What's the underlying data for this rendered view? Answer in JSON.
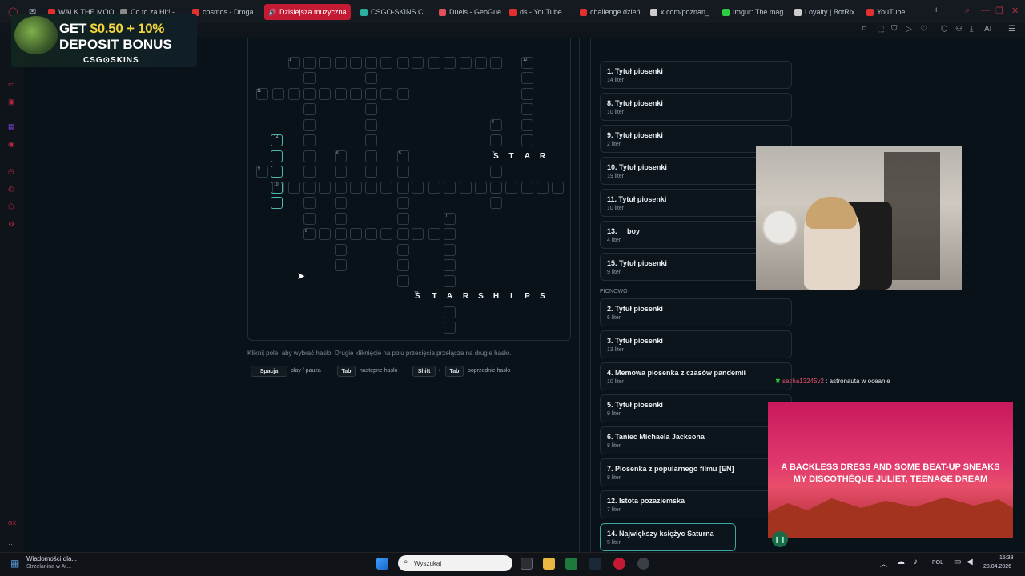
{
  "browser": {
    "tabs": [
      {
        "label": "WALK THE MOO",
        "color": "#e03030"
      },
      {
        "label": "Co to za Hit! - ",
        "color": "#888"
      },
      {
        "label": "cosmos - Droga",
        "color": "#e03030"
      },
      {
        "label": "Dzisiejsza muzyczna ",
        "color": "#fff",
        "active": true
      },
      {
        "label": "CSGO-SKINS.C",
        "color": "#2ab0a0"
      },
      {
        "label": "Duels - GeoGue",
        "color": "#e0505a"
      },
      {
        "label": "ds - YouTube",
        "color": "#e03030"
      },
      {
        "label": "challenge dzień",
        "color": "#e03030"
      },
      {
        "label": "x.com/poznan_",
        "color": "#ccc"
      },
      {
        "label": "Imgur: The mag",
        "color": "#2ecc40"
      },
      {
        "label": "Loyalty | BotRix",
        "color": "#ccc"
      },
      {
        "label": "YouTube",
        "color": "#e03030"
      }
    ],
    "new_tab_label": "+",
    "ai_label": "AI"
  },
  "ad": {
    "line1": "GET ",
    "line1_accent": "$0.50 + 10%",
    "line2": "DEPOSIT BONUS",
    "brand": "CSG⊙SKINS"
  },
  "crossword": {
    "typed_star": [
      "S",
      "T",
      "A",
      "R"
    ],
    "typed_starships": [
      "S",
      "T",
      "A",
      "R",
      "S",
      "H",
      "I",
      "P",
      "S"
    ],
    "numbers": [
      "1",
      "12",
      "11",
      "2",
      "14",
      "6",
      "5",
      "9",
      "10",
      "7",
      "8",
      "13",
      "3"
    ]
  },
  "hint": "Kliknij pole, aby wybrać hasło. Drugie kliknięcie na polu przecięcia przełącza na drugie hasło.",
  "shortcuts": [
    {
      "key": "Spacja",
      "desc": "play / pauza"
    },
    {
      "key": "Tab",
      "desc": "następne hasło"
    },
    {
      "key": "Shift",
      "plus": "+",
      "key2": "Tab",
      "desc": "poprzednie hasło"
    }
  ],
  "clues_across": [
    {
      "title": "1. Tytuł piosenki",
      "sub": "14 liter"
    },
    {
      "title": "8. Tytuł piosenki",
      "sub": "10 liter"
    },
    {
      "title": "9. Tytuł piosenki",
      "sub": "2 liter"
    },
    {
      "title": "10. Tytuł piosenki",
      "sub": "19 liter"
    },
    {
      "title": "11. Tytuł piosenki",
      "sub": "10 liter"
    },
    {
      "title": "13. __boy",
      "sub": "4 liter"
    },
    {
      "title": "15. Tytuł piosenki",
      "sub": "9 liter"
    }
  ],
  "down_heading": "PIONOWO",
  "clues_down": [
    {
      "title": "2. Tytuł piosenki",
      "sub": "6 liter"
    },
    {
      "title": "3. Tytuł piosenki",
      "sub": "13 liter"
    },
    {
      "title": "4. Memowa piosenka z czasów pandemii",
      "sub": "10 liter"
    },
    {
      "title": "5. Tytuł piosenki",
      "sub": "9 liter"
    },
    {
      "title": "6. Taniec Michaela Jacksona",
      "sub": "8 liter"
    },
    {
      "title": "7. Piosenka z popularnego filmu [EN]",
      "sub": "8 liter"
    },
    {
      "title": "12. Istota pozaziemska",
      "sub": "7 liter"
    },
    {
      "title": "14. Największy księżyc Saturna",
      "sub": "5 liter"
    }
  ],
  "chat": {
    "user": "sacha13245v2",
    "sep": " : ",
    "message": "astronauta w oceanie"
  },
  "music": {
    "line1": "A BACKLESS DRESS AND SOME BEAT-UP SNEAKS",
    "line2": "MY DISCOTHÈQUE JULIET, TEENAGE DREAM"
  },
  "taskbar": {
    "news_title": "Wiadomości dla...",
    "news_sub": "Strzelanina w At...",
    "search_placeholder": "Wyszukaj",
    "lang": "POL",
    "time": "15:38",
    "date": "28.04.2026"
  }
}
